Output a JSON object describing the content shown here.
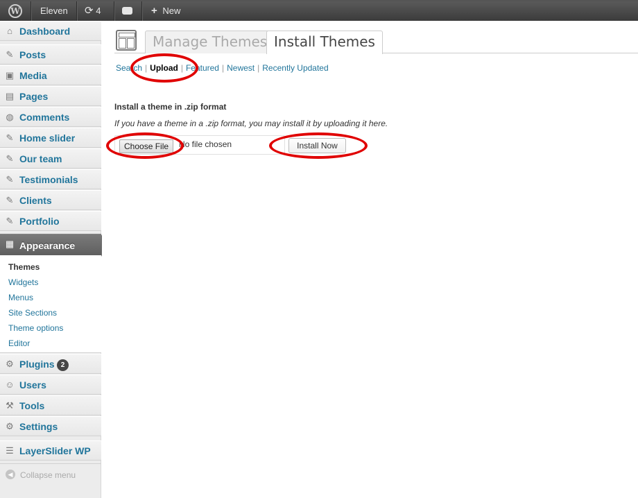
{
  "admin_bar": {
    "site_name": "Eleven",
    "updates_count": "4",
    "new_label": "New",
    "updates_icon": "refresh-icon",
    "comments_icon": "comment-bubble-icon",
    "new_icon": "plus-icon"
  },
  "sidebar": {
    "items": [
      {
        "label": "Dashboard",
        "icon": "dashboard-icon"
      },
      {
        "label": "Posts",
        "icon": "pin-icon"
      },
      {
        "label": "Media",
        "icon": "media-icon"
      },
      {
        "label": "Pages",
        "icon": "pages-icon"
      },
      {
        "label": "Comments",
        "icon": "comments-icon"
      },
      {
        "label": "Home slider",
        "icon": "pin-icon"
      },
      {
        "label": "Our team",
        "icon": "pin-icon"
      },
      {
        "label": "Testimonials",
        "icon": "pin-icon"
      },
      {
        "label": "Clients",
        "icon": "pin-icon"
      },
      {
        "label": "Portfolio",
        "icon": "pin-icon"
      },
      {
        "label": "Appearance",
        "icon": "appearance-icon"
      },
      {
        "label": "Plugins",
        "icon": "plugins-icon",
        "badge": "2"
      },
      {
        "label": "Users",
        "icon": "users-icon"
      },
      {
        "label": "Tools",
        "icon": "tools-icon"
      },
      {
        "label": "Settings",
        "icon": "settings-icon"
      },
      {
        "label": "LayerSlider WP",
        "icon": "layers-icon"
      }
    ],
    "appearance_submenu": [
      "Themes",
      "Widgets",
      "Menus",
      "Site Sections",
      "Theme options",
      "Editor"
    ],
    "collapse_label": "Collapse menu"
  },
  "main": {
    "tabs": [
      "Manage Themes",
      "Install Themes"
    ],
    "sub_links": [
      "Search",
      "Upload",
      "Featured",
      "Newest",
      "Recently Updated"
    ],
    "upload_title": "Install a theme in .zip format",
    "upload_desc": "If you have a theme in a .zip format, you may install it by uploading it here.",
    "choose_file_label": "Choose File",
    "file_status": "No file chosen",
    "install_label": "Install Now"
  },
  "colors": {
    "link": "#21759b",
    "admin_bar": "#464646",
    "highlight_ring": "#e00000"
  }
}
